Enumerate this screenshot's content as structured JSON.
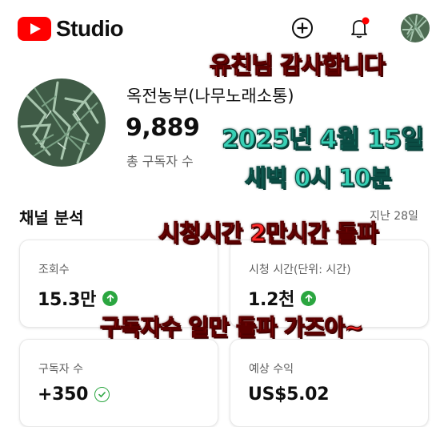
{
  "app": {
    "logo_text": "Studio"
  },
  "header": {
    "icons": [
      "youtube-play-icon",
      "create-plus-icon",
      "notification-bell-icon",
      "account-avatar"
    ],
    "notification_dot_color": "#ff0000"
  },
  "channel": {
    "name": "옥전농부(나무노래소통)",
    "subscribers": "9,889",
    "subscribers_label": "총 구독자 수"
  },
  "analytics": {
    "title": "채널 분석",
    "period": "지난 28일",
    "cards": [
      {
        "label": "조회수",
        "value": "15.3만",
        "indicator": "up-arrow"
      },
      {
        "label": "시청 시간(단위: 시간)",
        "value": "1.2천",
        "indicator": "up-arrow"
      },
      {
        "label": "구독자 수",
        "value": "+350",
        "indicator": "check"
      },
      {
        "label": "예상 수익",
        "value": "US$5.02",
        "indicator": ""
      }
    ]
  },
  "overlay_text": {
    "thanks": "유친님 감사합니다",
    "date": "2025년 4월 15일",
    "time": "새벽 0시 10분",
    "watch_milestone": "시청시간 2만시간 돌파",
    "goal": "구독자수 일만 돌파 가즈아~"
  },
  "colors": {
    "brand_red": "#ff0000",
    "trend_green": "#2ba640",
    "overlay_red": "#ff2a2a",
    "overlay_teal": "#37d0b5"
  }
}
